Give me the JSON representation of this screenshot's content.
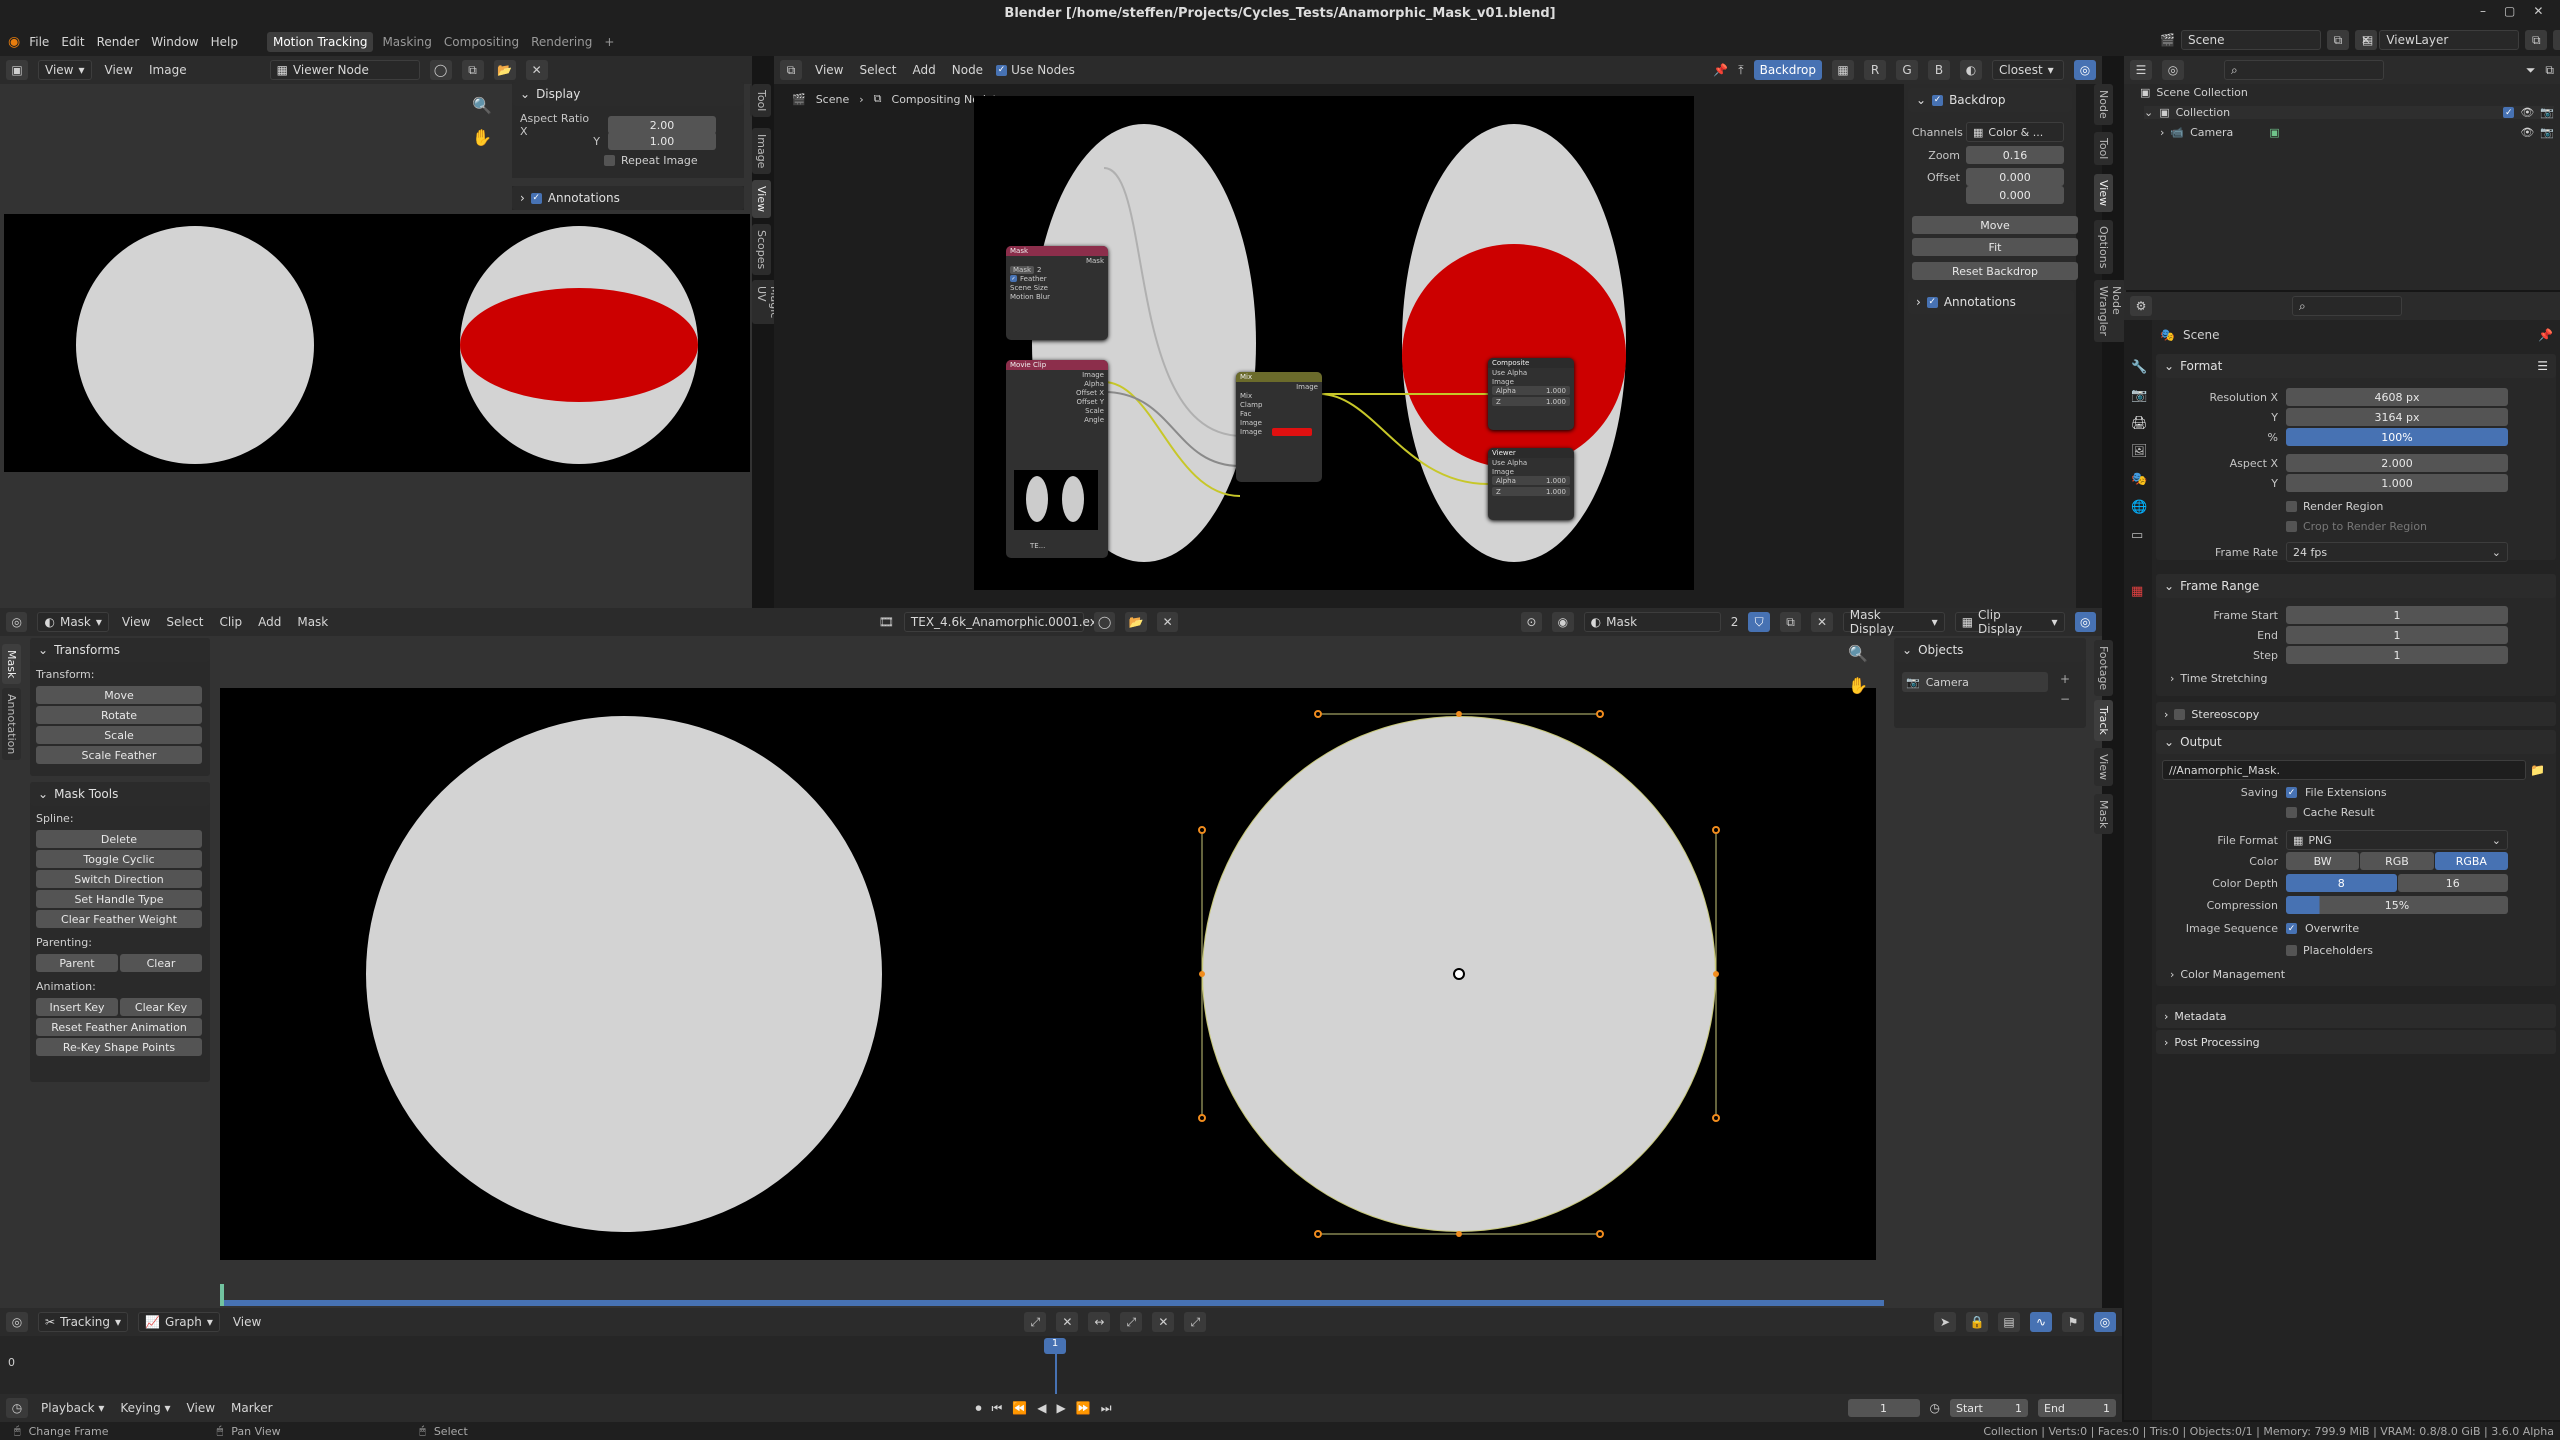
{
  "window": {
    "title": "Blender [/home/steffen/Projects/Cycles_Tests/Anamorphic_Mask_v01.blend]"
  },
  "topbar": {
    "menus": [
      "File",
      "Edit",
      "Render",
      "Window",
      "Help"
    ],
    "workspaces": [
      "Motion Tracking",
      "Masking",
      "Compositing",
      "Rendering"
    ],
    "active_workspace": "Motion Tracking",
    "add_tab": "+",
    "scene": "Scene",
    "view_layer": "ViewLayer"
  },
  "image_editor": {
    "menus": [
      "View",
      "View",
      "Image"
    ],
    "image_name": "Viewer Node",
    "display_panel": {
      "title": "Display",
      "aspect_ratio_label": "Aspect Ratio X",
      "aspect_x": "2.00",
      "y_label": "Y",
      "aspect_y": "1.00",
      "repeat_image": "Repeat Image"
    },
    "annotations": "Annotations",
    "tabs": [
      "Tool",
      "Image",
      "View",
      "Scopes",
      "Magic UV"
    ]
  },
  "compositor": {
    "menus": [
      "View",
      "Select",
      "Add",
      "Node"
    ],
    "use_nodes": "Use Nodes",
    "backdrop_btn": "Backdrop",
    "filter": "Closest",
    "breadcrumb": [
      "Scene",
      "Compositing Nodetree"
    ],
    "sidebar": {
      "backdrop": "Backdrop",
      "channels_label": "Channels",
      "channels": "Color & ...",
      "zoom_label": "Zoom",
      "zoom": "0.16",
      "offset_label": "Offset",
      "offset_x": "0.000",
      "offset_y": "0.000",
      "move": "Move",
      "fit": "Fit",
      "reset": "Reset Backdrop",
      "annotations": "Annotations"
    },
    "tabs": [
      "Node",
      "Tool",
      "View",
      "Options",
      "Node Wrangler"
    ],
    "nodes": {
      "mask": {
        "title": "Mask",
        "out": "Mask",
        "name": "Mask",
        "users": "2",
        "feather": "Feather",
        "scene_size": "Scene Size",
        "motion_blur": "Motion Blur"
      },
      "movieclip": {
        "title": "Movie Clip",
        "outputs": [
          "Image",
          "Alpha",
          "Offset X",
          "Offset Y",
          "Scale",
          "Angle"
        ],
        "clip": "TE..."
      },
      "mix": {
        "title": "Mix",
        "out": "Image",
        "mode": "Mix",
        "clamp": "Clamp",
        "fac": "Fac",
        "in1": "Image",
        "in2": "Image"
      },
      "composite": {
        "title": "Composite",
        "use_alpha": "Use Alpha",
        "image": "Image",
        "alpha": "Alpha",
        "alpha_v": "1.000",
        "z": "Z",
        "z_v": "1.000"
      },
      "viewer": {
        "title": "Viewer",
        "use_alpha": "Use Alpha",
        "image": "Image",
        "alpha": "Alpha",
        "alpha_v": "1.000",
        "z": "Z",
        "z_v": "1.000"
      }
    }
  },
  "outliner": {
    "search": "",
    "items": [
      {
        "label": "Scene Collection"
      },
      {
        "label": "Collection"
      },
      {
        "label": "Camera"
      }
    ]
  },
  "properties": {
    "scene": "Scene",
    "format": {
      "title": "Format",
      "res_x_label": "Resolution X",
      "res_x": "4608 px",
      "res_y_label": "Y",
      "res_y": "3164 px",
      "pct_label": "%",
      "pct": "100%",
      "aspect_x_label": "Aspect X",
      "aspect_x": "2.000",
      "aspect_y_label": "Y",
      "aspect_y": "1.000",
      "render_region": "Render Region",
      "crop": "Crop to Render Region",
      "fps_label": "Frame Rate",
      "fps": "24 fps"
    },
    "frame_range": {
      "title": "Frame Range",
      "start_label": "Frame Start",
      "start": "1",
      "end_label": "End",
      "end": "1",
      "step_label": "Step",
      "step": "1",
      "time_stretching": "Time Stretching"
    },
    "stereoscopy": "Stereoscopy",
    "output": {
      "title": "Output",
      "path": "//Anamorphic_Mask.",
      "saving_label": "Saving",
      "file_ext": "File Extensions",
      "cache": "Cache Result",
      "format_label": "File Format",
      "format": "PNG",
      "color_label": "Color",
      "bw": "BW",
      "rgb": "RGB",
      "rgba": "RGBA",
      "depth_label": "Color Depth",
      "d8": "8",
      "d16": "16",
      "comp_label": "Compression",
      "comp": "15%",
      "seq_label": "Image Sequence",
      "overwrite": "Overwrite",
      "placeholders": "Placeholders",
      "color_mgmt": "Color Management"
    },
    "metadata": "Metadata",
    "post": "Post Processing"
  },
  "clip_editor": {
    "mode": "Mask",
    "menus": [
      "View",
      "Select",
      "Clip",
      "Add",
      "Mask"
    ],
    "clip_name": "TEX_4.6k_Anamorphic.0001.exr",
    "mask_name": "Mask",
    "mask_users": "2",
    "mask_display": "Mask Display",
    "clip_display": "Clip Display",
    "tools": {
      "transforms": "Transforms",
      "transform_label": "Transform:",
      "move": "Move",
      "rotate": "Rotate",
      "scale": "Scale",
      "scale_feather": "Scale Feather",
      "mask_tools": "Mask Tools",
      "spline_label": "Spline:",
      "delete": "Delete",
      "toggle_cyclic": "Toggle Cyclic",
      "switch_dir": "Switch Direction",
      "set_handle": "Set Handle Type",
      "clear_feather": "Clear Feather Weight",
      "parenting_label": "Parenting:",
      "parent": "Parent",
      "clear": "Clear",
      "animation_label": "Animation:",
      "insert_key": "Insert Key",
      "clear_key": "Clear Key",
      "reset_feather": "Reset Feather Animation",
      "rekey": "Re-Key Shape Points"
    },
    "objects": {
      "title": "Objects",
      "camera": "Camera"
    },
    "left_tabs": [
      "Mask",
      "Annotation"
    ],
    "right_tabs": [
      "Footage",
      "Track",
      "View",
      "Mask"
    ]
  },
  "graph": {
    "mode": "Tracking",
    "view": "Graph",
    "menu": "View",
    "zero": "0",
    "frame": "1"
  },
  "timeline": {
    "menus": [
      "Playback",
      "Keying",
      "View",
      "Marker"
    ],
    "current": "1",
    "start_label": "Start",
    "start": "1",
    "end_label": "End",
    "end": "1"
  },
  "statusbar": {
    "hint1": "Change Frame",
    "hint2": "Pan View",
    "hint3": "Select",
    "stats": "Collection | Verts:0 | Faces:0 | Tris:0 | Objects:0/1 | Memory: 799.9 MiB | VRAM: 0.8/8.0 GiB | 3.6.0 Alpha"
  },
  "colors": {
    "accent": "#4772b3",
    "mask_red": "#cc0000",
    "node_mask": "#8c2e4b",
    "node_mix": "#6b6b2b",
    "node_out": "#2b2b2b"
  }
}
